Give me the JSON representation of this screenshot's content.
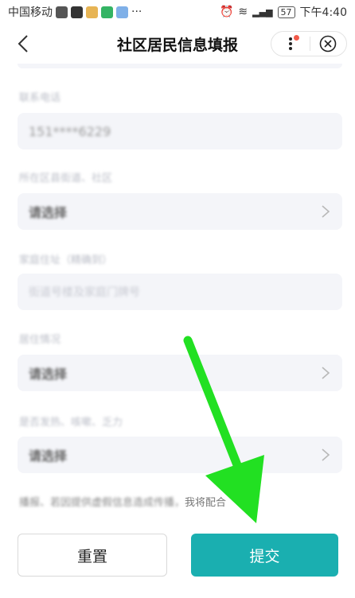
{
  "status_bar": {
    "carrier": "中国移动",
    "time": "下午4:40",
    "battery": "57",
    "network": "4G"
  },
  "nav": {
    "title": "社区居民信息填报",
    "back_icon": "back-chevron-icon",
    "more_icon": "more-dots-icon",
    "close_icon": "close-circle-icon"
  },
  "form": {
    "fields": [
      {
        "label": "联系电话",
        "value": "151****6229",
        "type": "text"
      },
      {
        "label": "所在区县街道、社区",
        "value": "请选择",
        "type": "select"
      },
      {
        "label": "家庭住址（精确到）",
        "placeholder": "街道号楼及家庭门牌号",
        "type": "text"
      },
      {
        "label": "居住情况",
        "value": "请选择",
        "type": "select"
      },
      {
        "label": "是否发热、咳嗽、乏力",
        "value": "请选择",
        "type": "select"
      }
    ],
    "consent_blurred": "播报、若因提供虚假信息造成传播，",
    "consent_visible": "我将配合"
  },
  "buttons": {
    "reset": "重置",
    "submit": "提交"
  },
  "colors": {
    "accent": "#1aafb0",
    "arrow": "#22e022",
    "field_bg": "#f4f5f9"
  }
}
